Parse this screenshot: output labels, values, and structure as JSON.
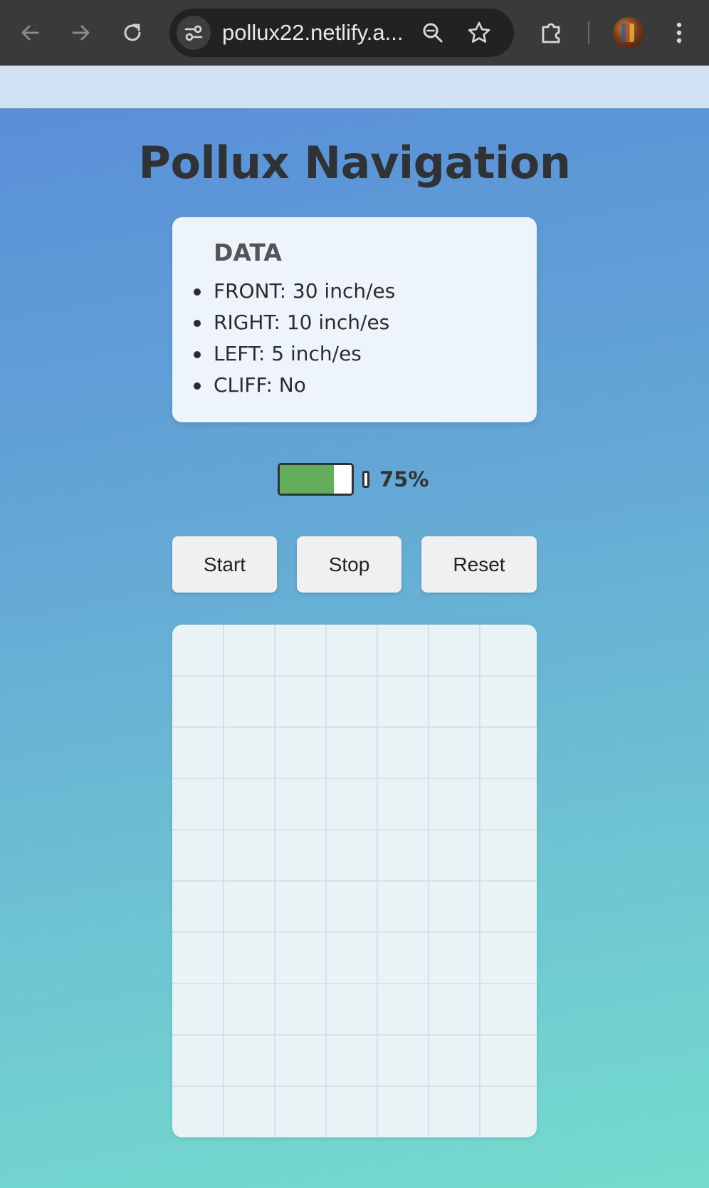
{
  "browser": {
    "url": "pollux22.netlify.a...",
    "icons": [
      "back-icon",
      "forward-icon",
      "reload-icon",
      "site-info-icon",
      "zoom-out-icon",
      "bookmark-star-icon",
      "extensions-icon",
      "profile-avatar",
      "more-menu-icon"
    ]
  },
  "page": {
    "title": "Pollux Navigation"
  },
  "data_panel": {
    "heading": "DATA",
    "items": [
      "FRONT: 30 inch/es",
      "RIGHT: 10 inch/es",
      "LEFT: 5 inch/es",
      "CLIFF: No"
    ]
  },
  "battery": {
    "level": 0.75,
    "label": "75%",
    "fill_color": "#64ad5c"
  },
  "controls": {
    "start": "Start",
    "stop": "Stop",
    "reset": "Reset"
  },
  "grid_map": {
    "columns": 7,
    "rows": 10,
    "line_color": "#c8dadd"
  }
}
